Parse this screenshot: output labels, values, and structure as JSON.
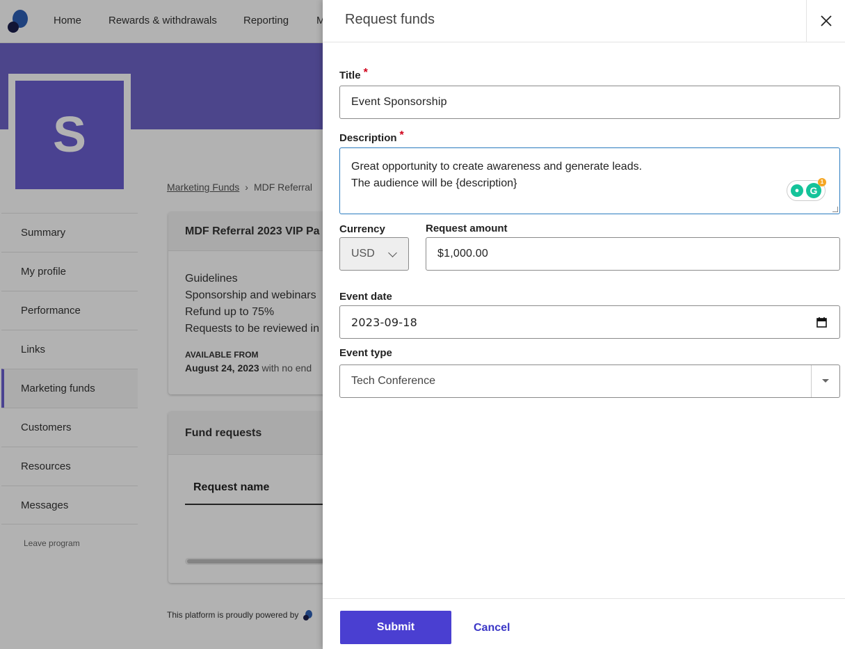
{
  "nav": {
    "items": [
      "Home",
      "Rewards & withdrawals",
      "Reporting",
      "M"
    ]
  },
  "profile": {
    "avatar_letter": "S"
  },
  "breadcrumb": {
    "parent": "Marketing Funds",
    "separator": "›",
    "current": "MDF Referral"
  },
  "sidebar": {
    "items": [
      "Summary",
      "My profile",
      "Performance",
      "Links",
      "Marketing funds",
      "Customers",
      "Resources",
      "Messages"
    ],
    "active": "Marketing funds",
    "leave": "Leave program"
  },
  "fund_card": {
    "title": "MDF Referral 2023 VIP Pa",
    "guidelines": [
      "Guidelines",
      "Sponsorship and webinars",
      "Refund up to 75%",
      "Requests to be reviewed in"
    ],
    "available_label": "AVAILABLE FROM",
    "available_date": "August 24, 2023",
    "available_suffix": " with no end"
  },
  "requests_card": {
    "title": "Fund requests",
    "column": "Request name"
  },
  "footer": {
    "powered_by": "This platform is proudly powered by"
  },
  "drawer": {
    "title": "Request funds",
    "fields": {
      "title_label": "Title",
      "title_value": "Event Sponsorship",
      "description_label": "Description",
      "description_line1": "Great opportunity to create awareness and generate leads.",
      "description_line2": "The audience will be {description}",
      "currency_label": "Currency",
      "currency_value": "USD",
      "amount_label": "Request amount",
      "amount_value": "$1,000.00",
      "event_date_label": "Event date",
      "event_date_value": "2023-09-18",
      "event_type_label": "Event type",
      "event_type_value": "Tech Conference"
    },
    "required_marker": "*",
    "grammarly_count": "1",
    "submit": "Submit",
    "cancel": "Cancel"
  },
  "colors": {
    "brand": "#4a3fd1",
    "banner": "#6e63c8",
    "required": "#d0021b",
    "focus_border": "#2a7bbf"
  },
  "icons": [
    "logo-icon",
    "close-icon",
    "chevron-down-icon",
    "calendar-icon",
    "caret-down-icon",
    "grammarly-icon",
    "bulb-icon"
  ]
}
